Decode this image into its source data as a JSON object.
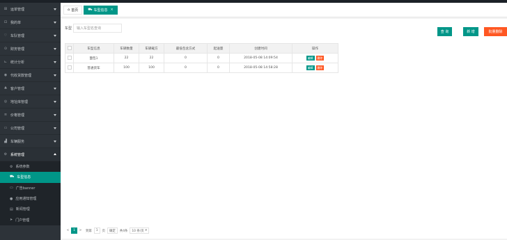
{
  "sidebar": {
    "items": [
      {
        "icon": "⊞",
        "label": "运单管理"
      },
      {
        "icon": "⊡",
        "label": "我的单"
      },
      {
        "icon": "♡",
        "label": "车队管理"
      },
      {
        "icon": "⊙",
        "label": "财务管理"
      },
      {
        "icon": "⊾",
        "label": "统计分析"
      },
      {
        "icon": "◉",
        "label": "代收货款管理"
      },
      {
        "icon": "♣",
        "label": "客户管理"
      },
      {
        "icon": "◎",
        "label": "地址库管理"
      },
      {
        "icon": "≡",
        "label": "价格管理"
      },
      {
        "icon": "▭",
        "label": "公司管理"
      },
      {
        "icon": "▟",
        "label": "车辆服务"
      },
      {
        "icon": "⚙",
        "label": "系统管理"
      }
    ],
    "submenu": [
      {
        "icon": "⚙",
        "label": "系统参数"
      },
      {
        "icon": "⛟",
        "label": "车型信息"
      },
      {
        "icon": "▭",
        "label": "广告banner"
      },
      {
        "icon": "●",
        "label": "应用通知管理"
      },
      {
        "icon": "▤",
        "label": "新闻管理"
      },
      {
        "icon": "➤",
        "label": "门户管理"
      }
    ]
  },
  "tabs": [
    {
      "icon": "⌂",
      "label": "首页"
    },
    {
      "icon": "⛟",
      "label": "车型信息",
      "close": "×"
    }
  ],
  "search": {
    "label": "车型",
    "placeholder": "输入车型名查询"
  },
  "buttons": {
    "query": "查 询",
    "add": "新 增",
    "batch_delete": "批量删除"
  },
  "table": {
    "headers": [
      "车型信息",
      "车辆数量",
      "车辆载方",
      "最低包含方式",
      "起送量",
      "创建时间",
      "操作"
    ],
    "rows": [
      {
        "name": "面包1",
        "count": "22",
        "capacity": "22",
        "min": "0",
        "start": "0",
        "created": "2018-05-08 14:09:54"
      },
      {
        "name": "普通货车",
        "count": "100",
        "capacity": "100",
        "min": "0",
        "start": "0",
        "created": "2018-05-08 14:58:28"
      }
    ],
    "op_edit": "编辑",
    "op_delete": "删除"
  },
  "pager": {
    "prev": "<",
    "current": "1",
    "next": ">",
    "goto_label": "到第",
    "goto_value": "1",
    "page_unit": "页",
    "confirm": "确定",
    "total": "共4条",
    "page_size": "10 条/页",
    "page_size_caret": "▾"
  },
  "colors": {
    "accent": "#009688",
    "danger": "#ff5722",
    "sidebar_bg": "#2d3339"
  }
}
